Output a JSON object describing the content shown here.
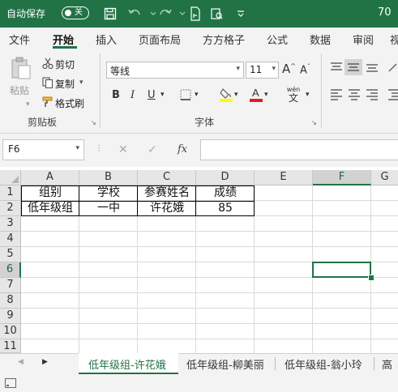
{
  "titlebar": {
    "autosave_label": "自动保存",
    "autosave_state": "关",
    "right_text": "70",
    "icons": [
      "save-icon",
      "undo-icon",
      "redo-icon",
      "touch-mode-icon",
      "customize-icon"
    ]
  },
  "ribbon_tabs": [
    "文件",
    "开始",
    "插入",
    "页面布局",
    "方方格子",
    "公式",
    "数据",
    "审阅",
    "视"
  ],
  "active_tab": "开始",
  "clipboard": {
    "paste": "粘贴",
    "cut": "剪切",
    "copy": "复制",
    "format_painter": "格式刷",
    "group_label": "剪贴板"
  },
  "font": {
    "name": "等线",
    "size": "11",
    "bold": "B",
    "italic": "I",
    "underline": "U",
    "grow": "A",
    "shrink": "A",
    "phonetic_top": "wén",
    "phonetic_bottom": "文",
    "group_label": "字体",
    "highlight_color": "#FFFF00",
    "font_color": "#E02020"
  },
  "formula_bar": {
    "cell_ref": "F6",
    "cancel": "✕",
    "enter": "✓",
    "fx": "fx",
    "value": ""
  },
  "columns": [
    "A",
    "B",
    "C",
    "D",
    "E",
    "F",
    "G"
  ],
  "selected_column": "F",
  "rows": [
    "1",
    "2",
    "3",
    "4",
    "5",
    "6",
    "7",
    "8",
    "9",
    "10",
    "11"
  ],
  "selected_row": "6",
  "table": {
    "headers": [
      "组别",
      "学校",
      "参赛姓名",
      "成绩"
    ],
    "row1": [
      "低年级组",
      "一中",
      "许花娥",
      "85"
    ]
  },
  "sheets": [
    "低年级组-许花娥",
    "低年级组-柳美丽",
    "低年级组-翁小玲",
    "高年"
  ],
  "active_sheet": "低年级组-许花娥",
  "accent_color": "#217346"
}
